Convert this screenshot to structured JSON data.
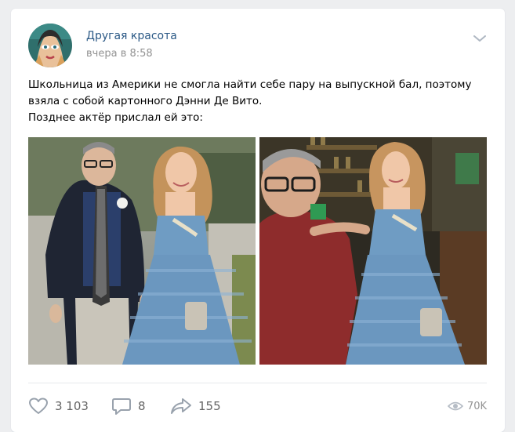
{
  "post": {
    "group_name": "Другая красота",
    "time": "вчера в 8:58",
    "text_lines": [
      "Школьница из Америки не смогла найти себе пару на выпускной бал, поэтому",
      "взяла с собой картонного Дэнни Де Вито.",
      "Позднее актёр прислал ей это:"
    ]
  },
  "actions": {
    "likes": "3 103",
    "comments": "8",
    "shares": "155",
    "views": "70K"
  },
  "icons": {
    "menu": "chevron-down-icon",
    "like": "heart-icon",
    "comment": "comment-icon",
    "share": "share-arrow-icon",
    "views": "eye-icon"
  },
  "colors": {
    "link": "#2a5885",
    "muted": "#939393",
    "action_text": "#656565",
    "dress_blue": "#6f9cc3"
  }
}
